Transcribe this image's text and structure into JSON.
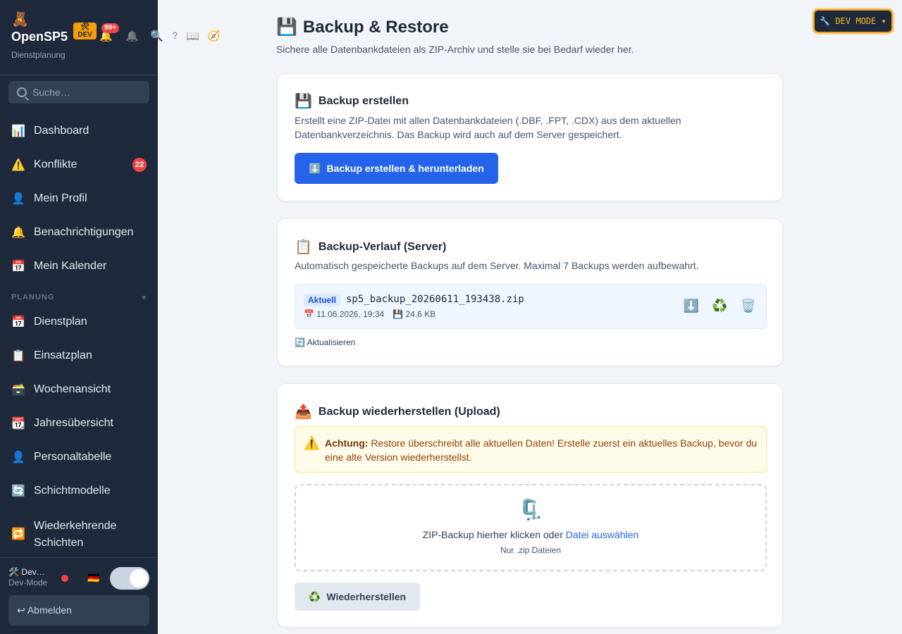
{
  "brand": {
    "logo_icon": "teddy-bear-icon",
    "logo_glyph": "🧸",
    "name": "OpenSP5",
    "subtitle": "Dienstplanung",
    "dev_badge": "DEV",
    "dev_badge_glyph": "🛠",
    "notification_count": "99+"
  },
  "topbar_icons": {
    "bell": "🔔",
    "bell_outline": "🔔",
    "search": "🔍",
    "help": "?",
    "book": "📖",
    "compass": "🧭"
  },
  "search": {
    "placeholder": "Suche…"
  },
  "nav": {
    "dashboard": {
      "icon": "📊",
      "label": "Dashboard"
    },
    "konflikte": {
      "icon": "⚠️",
      "label": "Konflikte",
      "badge": "22"
    },
    "profil": {
      "icon": "👤",
      "label": "Mein Profil"
    },
    "benachrichtigungen": {
      "icon": "🔔",
      "label": "Benachrichtigungen"
    },
    "kalender": {
      "icon": "📅",
      "label": "Mein Kalender"
    },
    "section_planung": "PLANUNG",
    "section_chevron": "▾",
    "dienstplan": {
      "icon": "📅",
      "label": "Dienstplan"
    },
    "einsatzplan": {
      "icon": "📋",
      "label": "Einsatzplan"
    },
    "wochenansicht": {
      "icon": "🗃️",
      "label": "Wochenansicht"
    },
    "jahresuebersicht": {
      "icon": "📆",
      "label": "Jahresübersicht"
    },
    "personaltabelle": {
      "icon": "👤",
      "label": "Personaltabelle"
    },
    "schichtmodelle": {
      "icon": "🔄",
      "label": "Schichtmodelle"
    },
    "wiederkehrende_1": "Wiederkehrende",
    "wiederkehrende_2": "Schichten",
    "wiederkehrende_icon": "🔁"
  },
  "footer": {
    "user_name": "🛠️ Dev…",
    "user_role": "Dev-Mode",
    "flag": "🇩🇪",
    "logout": "↩ Abmelden"
  },
  "dev_mode_button": "🔧 DEV MODE ▾",
  "page": {
    "title_icon": "💾",
    "title": "Backup & Restore",
    "subtitle": "Sichere alle Datenbankdateien als ZIP-Archiv und stelle sie bei Bedarf wieder her."
  },
  "card_create": {
    "icon": "💾",
    "title": "Backup erstellen",
    "text": "Erstellt eine ZIP-Datei mit allen Datenbankdateien (.DBF, .FPT, .CDX) aus dem aktuellen Datenbankverzeichnis. Das Backup wird auch auf dem Server gespeichert.",
    "button_icon": "⬇️",
    "button": "Backup erstellen & herunterladen"
  },
  "card_history": {
    "icon": "📋",
    "title": "Backup-Verlauf (Server)",
    "text": "Automatisch gespeicherte Backups auf dem Server. Maximal 7 Backups werden aufbewahrt.",
    "backups": [
      {
        "tag": "Aktuell",
        "file": "sp5_backup_20260611_193438.zip",
        "date_icon": "📅",
        "date": "11.06.2026, 19:34",
        "size_icon": "💾",
        "size": "24.6 KB"
      }
    ],
    "action_download": "⬇️",
    "action_restore": "♻️",
    "action_delete": "🗑️",
    "refresh": "🔄 Aktualisieren"
  },
  "card_restore": {
    "icon": "📤",
    "title": "Backup wiederherstellen (Upload)",
    "warning_icon": "⚠️",
    "warning_bold": "Achtung:",
    "warning_text": " Restore überschreibt alle aktuellen Daten! Erstelle zuerst ein aktuelles Backup, bevor du eine alte Version wiederherstellst.",
    "dropzone_icon": "🗜️",
    "dropzone_text": "ZIP-Backup hierher klicken oder ",
    "dropzone_link": "Datei auswählen",
    "dropzone_hint": "Nur .zip Dateien",
    "button_icon": "♻️",
    "button": "Wiederherstellen"
  }
}
